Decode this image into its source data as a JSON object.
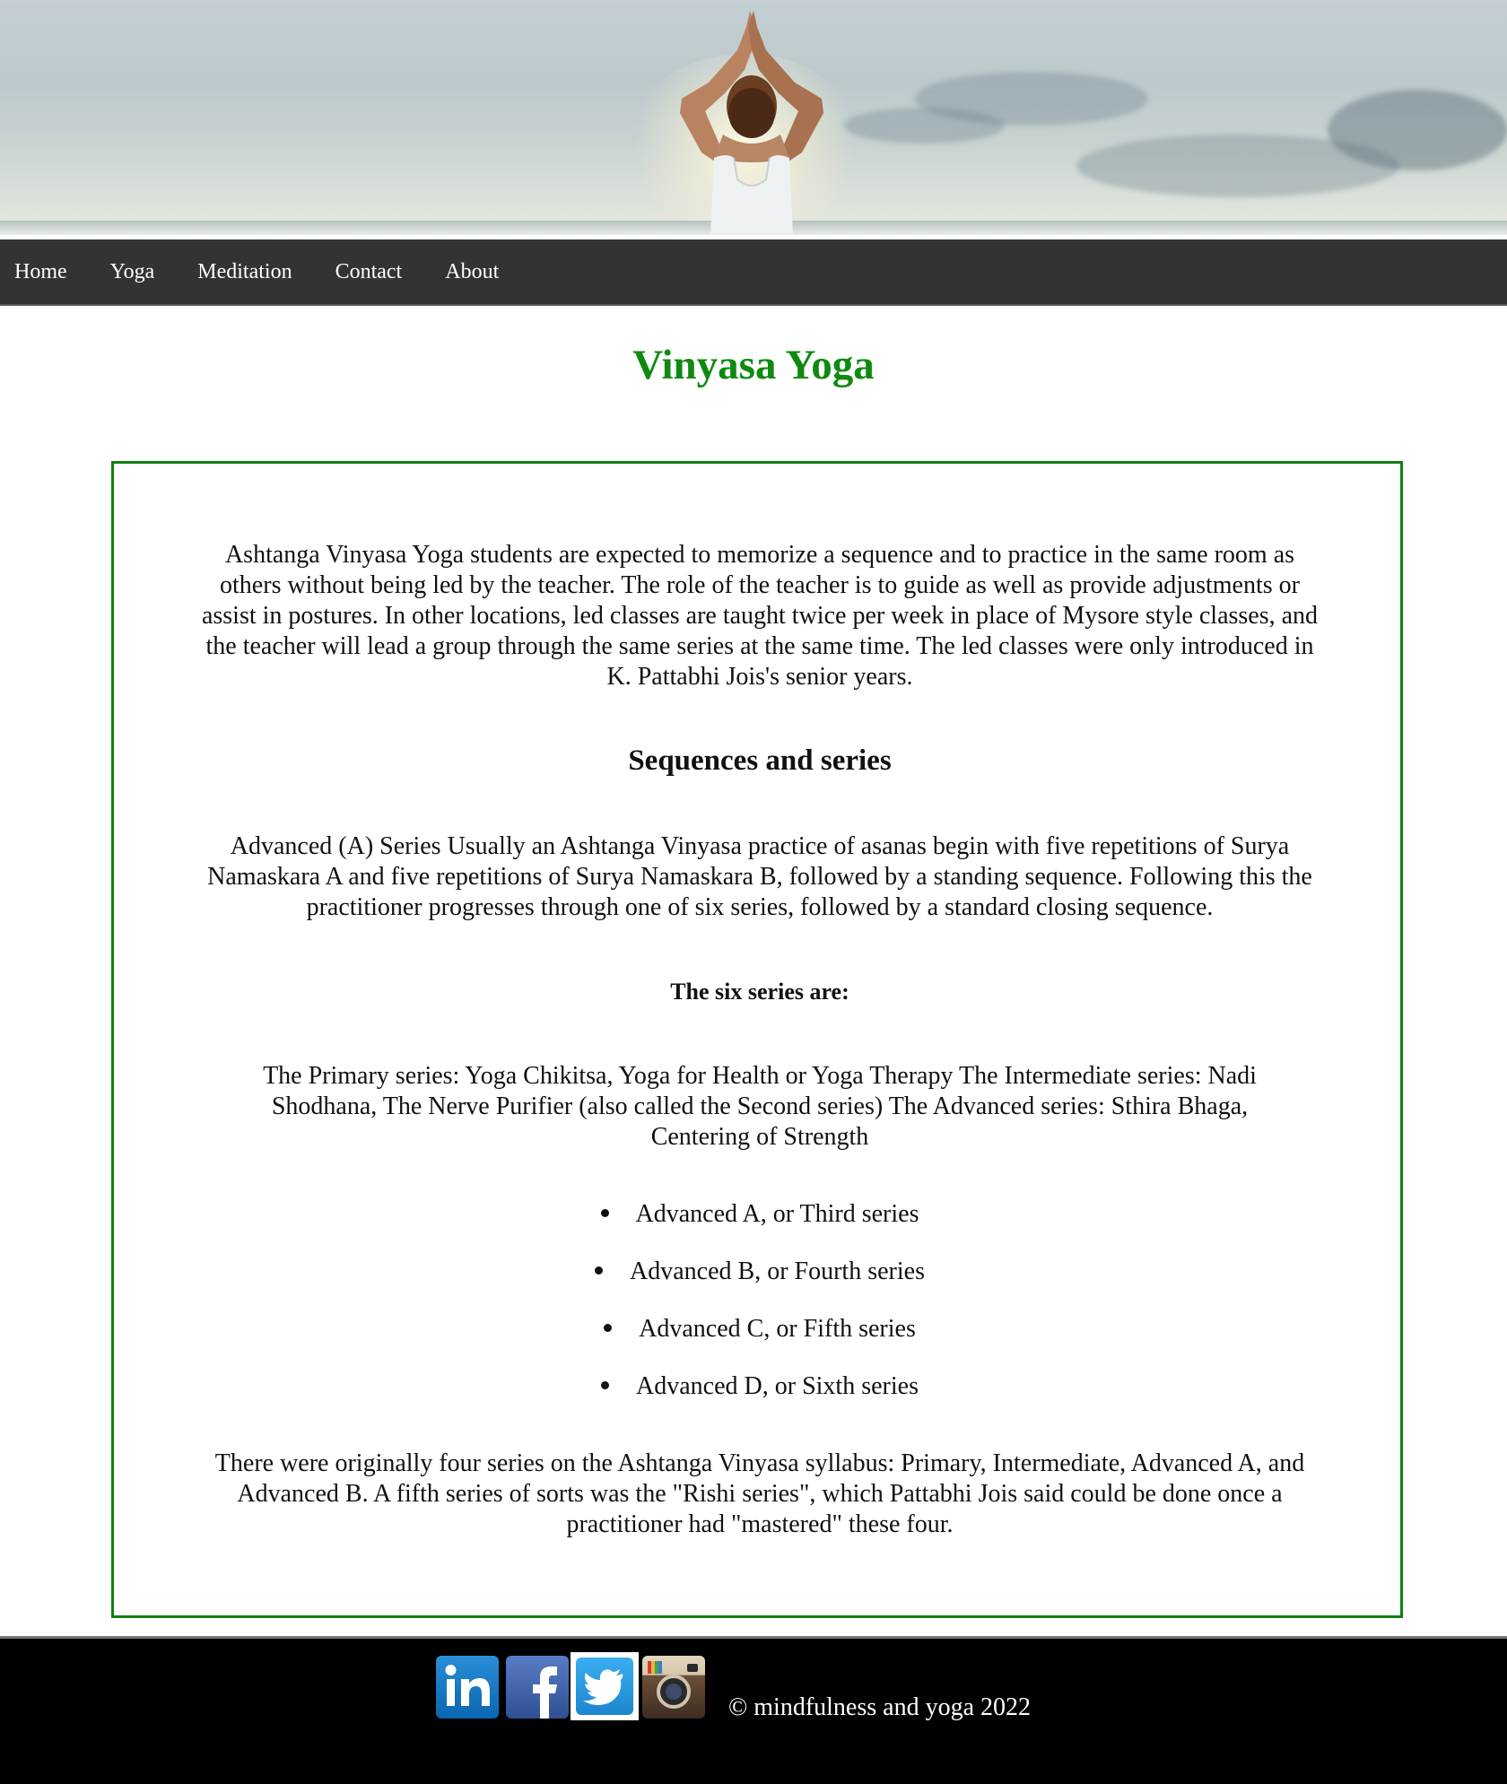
{
  "nav": {
    "items": [
      {
        "label": "Home"
      },
      {
        "label": "Yoga"
      },
      {
        "label": "Meditation"
      },
      {
        "label": "Contact"
      },
      {
        "label": "About"
      }
    ]
  },
  "page": {
    "title": "Vinyasa Yoga"
  },
  "content": {
    "intro": "Ashtanga Vinyasa Yoga students are expected to memorize a sequence and to practice in the same room as others without being led by the teacher. The role of the teacher is to guide as well as provide adjustments or assist in postures. In other locations, led classes are taught twice per week in place of Mysore style classes, and the teacher will lead a group through the same series at the same time. The led classes were only introduced in K. Pattabhi Jois's senior years.",
    "section_heading": "Sequences and series",
    "advanced_para": "Advanced (A) Series Usually an Ashtanga Vinyasa practice of asanas begin with five repetitions of Surya Namaskara A and five repetitions of Surya Namaskara B, followed by a standing sequence. Following this the practitioner progresses through one of six series, followed by a standard closing sequence.",
    "six_series_heading": "The six series are:",
    "series_para": "The Primary series: Yoga Chikitsa, Yoga for Health or Yoga Therapy The Intermediate series: Nadi Shodhana, The Nerve Purifier (also called the Second series) The Advanced series: Sthira Bhaga, Centering of Strength",
    "series_list": [
      "Advanced A, or Third series",
      "Advanced B, or Fourth series",
      "Advanced C, or Fifth series",
      "Advanced D, or Sixth series"
    ],
    "closing_para": "There were originally four series on the Ashtanga Vinyasa syllabus: Primary, Intermediate, Advanced A, and Advanced B. A fifth series of sorts was the \"Rishi series\", which Pattabhi Jois said could be done once a practitioner had \"mastered\" these four."
  },
  "footer": {
    "social": [
      {
        "icon": "linkedin-icon"
      },
      {
        "icon": "facebook-icon"
      },
      {
        "icon": "twitter-icon"
      },
      {
        "icon": "instagram-icon"
      }
    ],
    "copyright": "© mindfulness and yoga 2022"
  },
  "colors": {
    "title_green": "#0f8a0f",
    "box_border": "#108010",
    "nav_bg": "#333333",
    "footer_bg": "#000000"
  }
}
